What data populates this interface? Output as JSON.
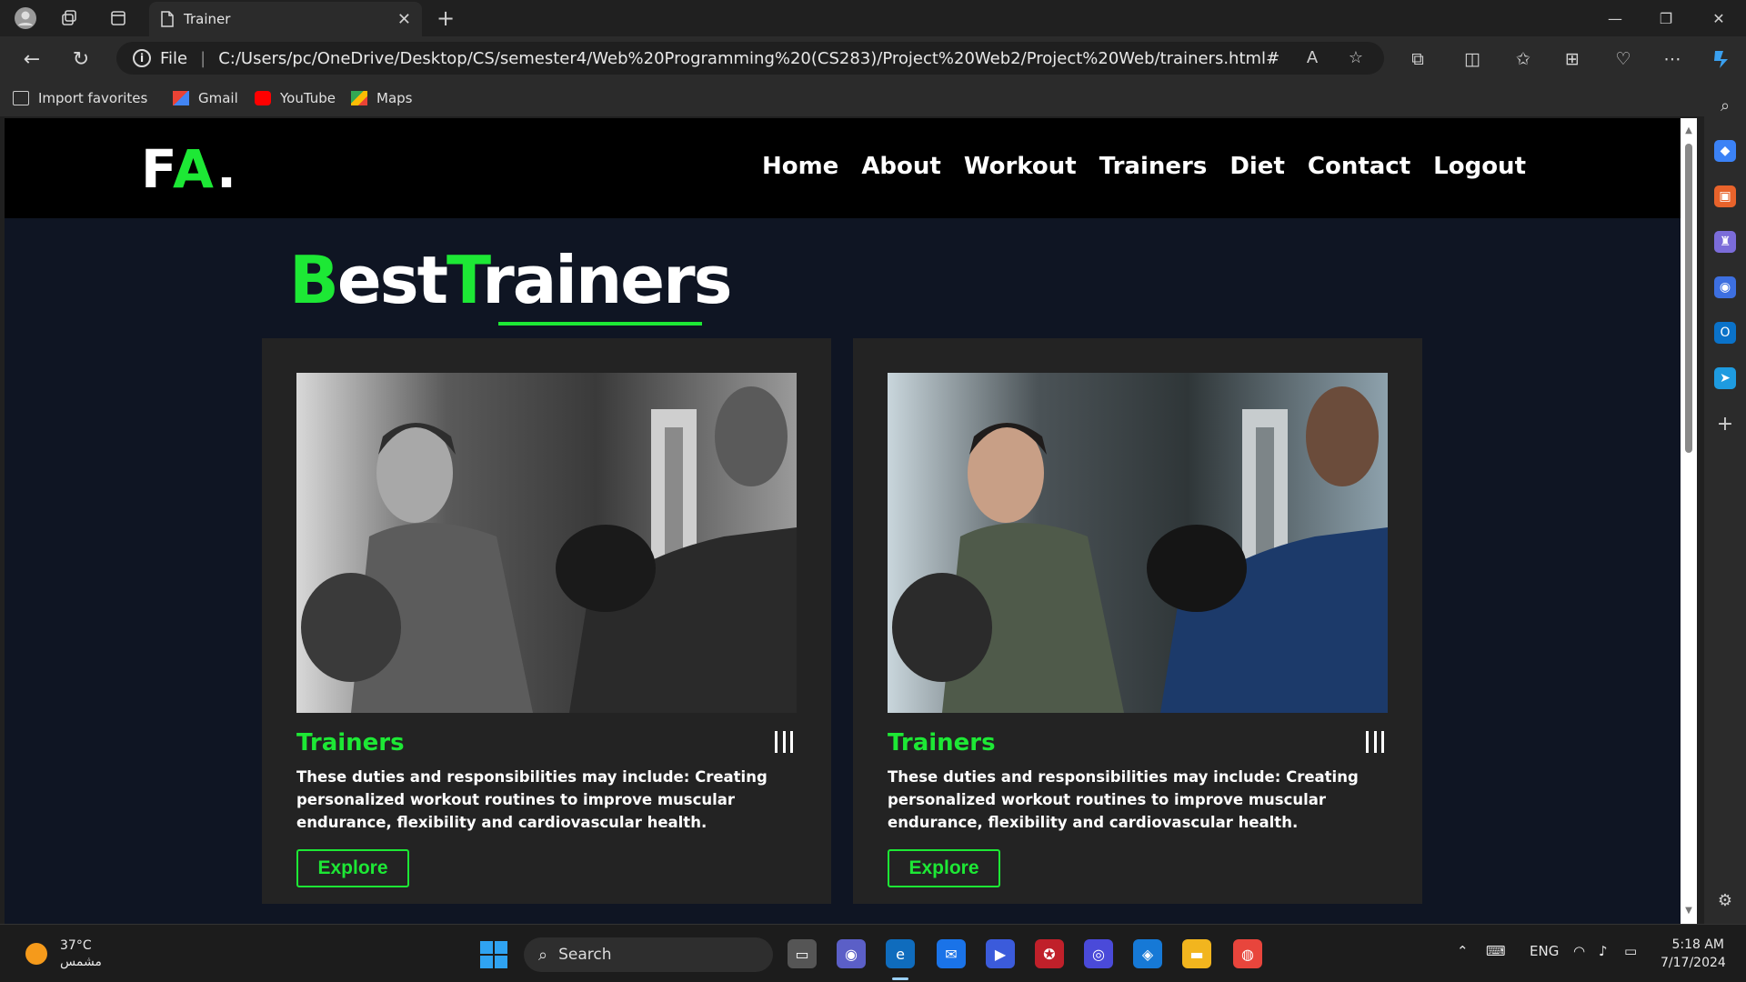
{
  "browser": {
    "tab_title": "Trainer",
    "tab_close": "✕",
    "new_tab": "+",
    "address_scheme": "File",
    "address_url": "C:/Users/pc/OneDrive/Desktop/CS/semester4/Web%20Programming%20(CS283)/Project%20Web2/Project%20Web/trainers.html#",
    "favorites": [
      "Import favorites",
      "Gmail",
      "YouTube",
      "Maps"
    ]
  },
  "site": {
    "logo": {
      "part1": "F",
      "part2": "A",
      "part3": "."
    },
    "nav": [
      "Home",
      "About",
      "Workout",
      "Trainers",
      "Diet",
      "Contact",
      "Logout"
    ],
    "heading": {
      "g1": "B",
      "w1": "est",
      "g2": "T",
      "w2": "rainers"
    },
    "cards": [
      {
        "image": "grayscale boxing training photo",
        "title": "Trainers",
        "text": "These duties and responsibilities may include: Creating personalized workout routines to improve muscular endurance, flexibility and cardiovascular health.",
        "button": "Explore"
      },
      {
        "image": "color boxing training photo",
        "title": "Trainers",
        "text": "These duties and responsibilities may include: Creating personalized workout routines to improve muscular endurance, flexibility and cardiovascular health.",
        "button": "Explore"
      }
    ]
  },
  "taskbar": {
    "weather_temp": "37°C",
    "weather_desc": "مشمس",
    "search_placeholder": "Search",
    "language": "ENG",
    "time": "5:18 AM",
    "date": "7/17/2024"
  },
  "colors": {
    "accent_green": "#1de835",
    "page_bg": "#0f1523",
    "card_bg": "#232323",
    "header_bg": "#000000"
  }
}
